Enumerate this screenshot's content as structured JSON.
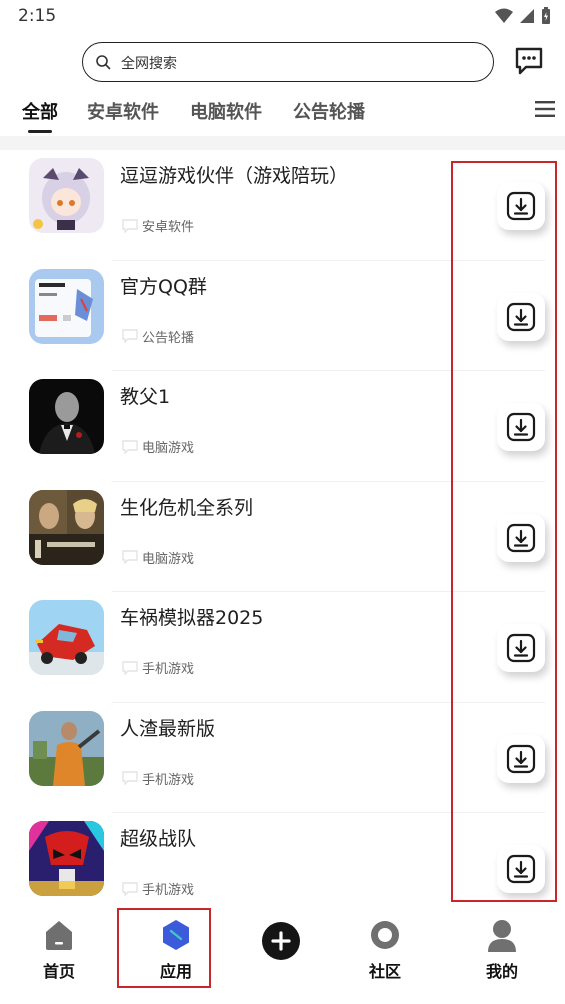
{
  "status_bar": {
    "time": "2:15"
  },
  "search": {
    "placeholder": "全网搜索"
  },
  "tabs": [
    {
      "label": "全部",
      "active": true
    },
    {
      "label": "安卓软件",
      "active": false
    },
    {
      "label": "电脑软件",
      "active": false
    },
    {
      "label": "公告轮播",
      "active": false
    }
  ],
  "apps": [
    {
      "title": "逗逗游戏伙伴（游戏陪玩）",
      "category": "安卓软件",
      "icon": "anime-girl-icon"
    },
    {
      "title": "官方QQ群",
      "category": "公告轮播",
      "icon": "qq-group-notice-icon"
    },
    {
      "title": "教父1",
      "category": "电脑游戏",
      "icon": "godfather-icon"
    },
    {
      "title": "生化危机全系列",
      "category": "电脑游戏",
      "icon": "resident-evil-icon"
    },
    {
      "title": "车祸模拟器2025",
      "category": "手机游戏",
      "icon": "car-crash-icon"
    },
    {
      "title": "人渣最新版",
      "category": "手机游戏",
      "icon": "scum-icon"
    },
    {
      "title": "超级战队",
      "category": "手机游戏",
      "icon": "super-sentai-icon"
    }
  ],
  "bottom_nav": {
    "home": "首页",
    "apps": "应用",
    "community": "社区",
    "mine": "我的"
  },
  "colors": {
    "highlight": "#c9252c",
    "active_tab_icon": "#3b5bdb"
  }
}
